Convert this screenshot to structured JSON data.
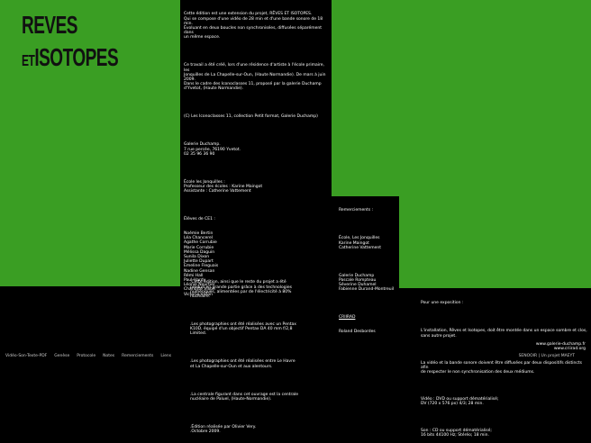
{
  "title": {
    "line1": "REVES",
    "line2_prefix": "ET",
    "line2": "ISOTOPES"
  },
  "intro": {
    "p1": "Cette édition est une extension du projet, RÊVES ET ISOTOPES.\nQui se compose d'une vidéo de 28 min et d'une bande sonore de 18 min.\nÉvoluant en deux boucles non synchronisées, diffusées séparément dans\nun même espace.",
    "p2": "Ce travail a été créé, lors d'une résidence d'artiste à l'école primaire, les\nJonquilles de La Chapelle-sur-Oun, (Haute Normandie). De mars à juin\n2009.\nDans le cadre des Iconoclasses 11, proposé par la galerie Duchamp\nd'Yvetot, (Haute Normandie).",
    "p3": "(C) Les Iconoclasses 11, collection Petit format, Galerie Duchamp)",
    "p4": "Galerie Duchamp.\n7 rue percée, 76190 Yvetot.\n02 35 96 36 90",
    "p5": "École les Jonquilles :\nProfesseur des écoles : Karine Maingot\nAssistante : Catherine Vattement",
    "p6_head": "Élèves de CE1 :",
    "students": [
      "Noémie Bertin",
      "Léa Chancerel",
      "Agathe Corrubie",
      "Marie Corrubie",
      "Mélissa Daguin",
      "Sunila Dixon",
      "Juliette Dupart",
      "Emeline Fleguais",
      "Nadine Gensan",
      "Rémi Hall",
      "Paul Hardy",
      "Léonie Nourtier",
      "Charlotte Vixon",
      "Victoria Vision"
    ]
  },
  "thanks": {
    "head": "Remerciements :",
    "g1": "École, Les Jonquilles\nKarine Maingot\nCatherine Vattement",
    "g2": "Galerie Duchamp\nPascale Rompteau\nSéverine Duhamel\nFabienne Durand-Montreuil",
    "g3_head": "CRIIRAD",
    "g3": "Roland Desbordes"
  },
  "edition": {
    "p1": ".Cette édition, ainsi que le reste du projet a été\nproduit en grande partie grâce à des technologies\nnumériques, alimentées par de l'électricité à 80%\nnucléaire.",
    "p2": ".Les photographies ont été réalisées avec un Pentax\nK10D, équipé d'un objectif Pentax DA 40 mm f/2,8\nLimited.",
    "p3": ".Les photographies ont été réalisées entre Le Havre\net La Chapelle-sur-Oun et aux alentours.",
    "p4": ".La centrale figurant dans cet ouvrage est la centrale\nnucléaire de Paluel, (Haute-Normandie).",
    "p5": ".Édition réalisée par Olivier Very.\n.Octobre 2009."
  },
  "expo": {
    "head": "Pour une exposition :",
    "p1": "L'installation, Rêves et Isotopes, doit être montée dans un espace sombre et clos,\nsans autre projet.",
    "p2": "La vidéo et la bande sonore doivent être diffusées par deux dispositifs distincts afin\nde respecter le non synchronisation des deux médiums.",
    "p3": "Vidéo : DVD ou support dématérialisé;\nDV (720 x 576 px) 4/3; 28 min.",
    "p4": "Son : CD ou support dématérialisé;\n16 bits 44100 Hz; Stéréo; 18 min.",
    "links": "www.galerie-duchamp.fr\nwww.criirad.org"
  },
  "nav": [
    "Vidéo-Son-Texte-PDF",
    "Genèse",
    "Protocole",
    "Notes",
    "Remerciements",
    "Liens"
  ],
  "footer": "SENOOIR | Un projet MAEYT",
  "colors": {
    "green": "#3a9e23",
    "black": "#000000"
  }
}
